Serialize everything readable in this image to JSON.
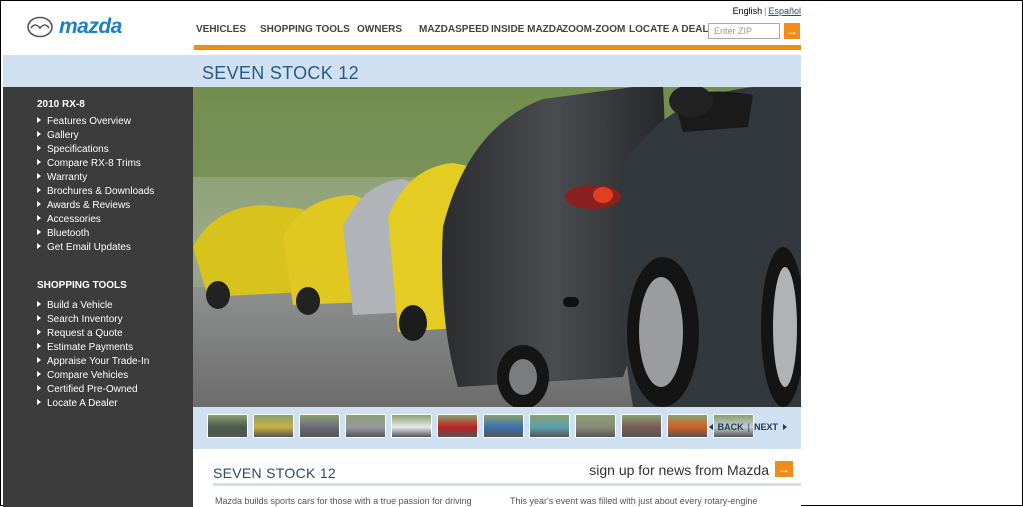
{
  "brand": {
    "name": "mazda"
  },
  "language": {
    "current": "English",
    "alternate": "Español"
  },
  "nav": [
    "VEHICLES",
    "SHOPPING TOOLS",
    "OWNERS",
    "MAZDASPEED",
    "INSIDE MAZDA",
    "ZOOM-ZOOM",
    "LOCATE A DEALER"
  ],
  "zip": {
    "placeholder": "Enter ZIP",
    "go": "→"
  },
  "page_title": "SEVEN STOCK 12",
  "sidebar": {
    "vehicle_heading": "2010 RX-8",
    "vehicle_items": [
      "Features Overview",
      "Gallery",
      "Specifications",
      "Compare RX-8 Trims",
      "Warranty",
      "Brochures & Downloads",
      "Awards & Reviews",
      "Accessories",
      "Bluetooth",
      "Get Email Updates"
    ],
    "tools_heading": "SHOPPING TOOLS",
    "tools_items": [
      "Build a Vehicle",
      "Search Inventory",
      "Request a Quote",
      "Estimate Payments",
      "Appraise Your Trade-In",
      "Compare Vehicles",
      "Certified Pre-Owned",
      "Locate A Dealer"
    ]
  },
  "gallery": {
    "back": "BACK",
    "next": "NEXT",
    "thumb_colors": [
      "#4a5a4a",
      "#c9b040",
      "#6a6a7a",
      "#9a9aa2",
      "#e8e8ea",
      "#c02020",
      "#3a70b0",
      "#5aa0b0",
      "#8a8a7a",
      "#7a5a5a",
      "#d06020",
      "#c8ccd0"
    ]
  },
  "content": {
    "section_title": "SEVEN STOCK 12",
    "signup": "sign up for news from Mazda",
    "signup_go": "→",
    "para_left": "Mazda builds sports cars for those with a true passion for driving",
    "para_right": "This year's event was filled with just about every rotary-engine"
  },
  "colors": {
    "accent": "#f08c1a",
    "band": "#cfe1f0",
    "sidebar": "#3c3c3c",
    "title": "#2a5a84"
  }
}
